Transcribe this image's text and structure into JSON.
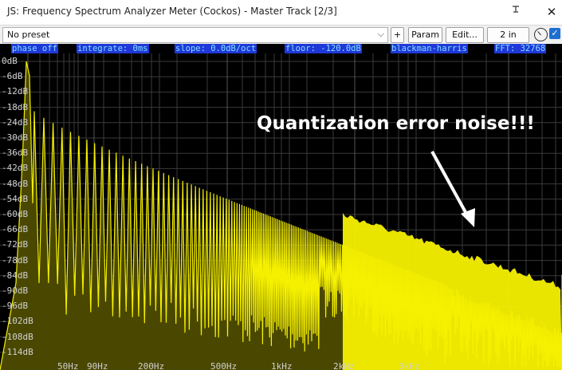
{
  "window": {
    "title": "JS: Frequency Spectrum Analyzer Meter (Cockos) - Master Track [2/3]",
    "pin_label": "",
    "close_glyph": "✕"
  },
  "toolbar": {
    "preset_value": "No preset",
    "plus_label": "+",
    "param_label": "Param",
    "edit_label": "Edit...",
    "io_label": "2 in",
    "enabled": true
  },
  "status_bar": [
    "phase off",
    "integrate: 0ms",
    "slope: 0.0dB/oct",
    "floor: -120.0dB",
    "blackman-harris",
    "FFT: 32768"
  ],
  "db_labels": [
    "0dB",
    "-6dB",
    "-12dB",
    "-18dB",
    "-24dB",
    "-30dB",
    "-36dB",
    "-42dB",
    "-48dB",
    "-54dB",
    "-60dB",
    "-66dB",
    "-72dB",
    "-78dB",
    "-84dB",
    "-90dB",
    "-96dB",
    "-102dB",
    "-108dB",
    "-114dB"
  ],
  "hz_labels": [
    "50Hz",
    "90Hz",
    "200Hz",
    "500Hz",
    "1kHz",
    "2kHz",
    "3kHz"
  ],
  "annotation": {
    "text": "Quantization error noise!!!"
  },
  "colors": {
    "spectrum": "#f5f000",
    "spectrum_fill": "#4a4800",
    "grid": "#3a3a3a",
    "status_bg": "#1f38d8",
    "status_text": "#7fe0ff",
    "annotation": "#ffffff"
  }
}
